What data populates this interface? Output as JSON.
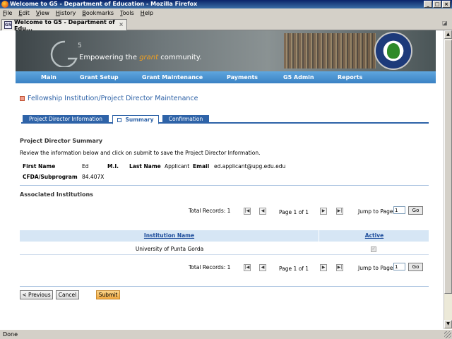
{
  "window": {
    "title": "Welcome to G5 - Department of Education - Mozilla Firefox",
    "status": "Done"
  },
  "menu": [
    "File",
    "Edit",
    "View",
    "History",
    "Bookmarks",
    "Tools",
    "Help"
  ],
  "browser_tab": {
    "title": "Welcome to G5 - Department of Edu...",
    "icon_text": "G5"
  },
  "banner": {
    "logo": "G5",
    "tagline_pre": "Empowering the ",
    "tagline_grant": "grant",
    "tagline_post": " community.",
    "seal": "DEPARTMENT OF EDUCATION"
  },
  "nav": [
    "Main",
    "Grant Setup",
    "Grant Maintenance",
    "Payments",
    "G5 Admin",
    "Reports"
  ],
  "page_title": "Fellowship Institution/Project Director Maintenance",
  "tabs": {
    "pd_info": "Project Director Information",
    "summary": "Summary",
    "confirmation": "Confirmation"
  },
  "summary": {
    "title": "Project Director Summary",
    "description": "Review the information below and click on submit to save the Project Director Information.",
    "first_name_label": "First Name",
    "first_name": "Ed",
    "mi_label": "M.I.",
    "mi": "",
    "last_name_label": "Last Name",
    "last_name": "Applicant",
    "email_label": "Email",
    "email": "ed.applicant@upg.edu.edu",
    "cfda_label": "CFDA/Subprogram",
    "cfda": "84.407X"
  },
  "institutions": {
    "title": "Associated Institutions",
    "total_records": "Total Records: 1",
    "page_of": "Page 1 of 1",
    "jump_label": "Jump to Page",
    "jump_value": "1",
    "go_label": "Go",
    "col_name": "Institution Name",
    "col_active": "Active",
    "rows": [
      {
        "name": "University of Punta Gorda",
        "active": "✓"
      }
    ]
  },
  "buttons": {
    "previous": "< Previous",
    "cancel": "Cancel",
    "submit": "Submit"
  }
}
